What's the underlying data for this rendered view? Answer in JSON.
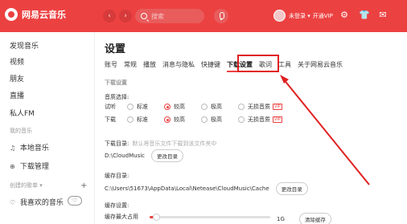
{
  "app": {
    "name": "网易云音乐"
  },
  "titlebar": {
    "back": "‹",
    "forward": "›",
    "search_placeholder": "搜索",
    "user_label": "未登录 ▾",
    "vip_label": "开通VIP"
  },
  "sidebar": {
    "items": [
      {
        "label": "发现音乐"
      },
      {
        "label": "视频"
      },
      {
        "label": "朋友"
      },
      {
        "label": "直播"
      },
      {
        "label": "私人FM"
      }
    ],
    "section_mine": "我的音乐",
    "local_music": "本地音乐",
    "download_manage": "下载管理",
    "section_created": "创建的歌单",
    "created_arrow": "▾",
    "plus": "+",
    "liked": "我喜欢的音乐"
  },
  "settings": {
    "title": "设置",
    "tabs": [
      {
        "label": "账号"
      },
      {
        "label": "常规"
      },
      {
        "label": "播放"
      },
      {
        "label": "消息与隐私"
      },
      {
        "label": "快捷键"
      },
      {
        "label": "下载设置",
        "active": true
      },
      {
        "label": "歌词"
      },
      {
        "label": "工具"
      },
      {
        "label": "关于网易云音乐"
      }
    ],
    "section_download": "下载设置",
    "quality_title": "音质选择:",
    "quality_rows": [
      {
        "label": "试听",
        "options": [
          "标准",
          "较高",
          "极高",
          "无损音质"
        ],
        "selected": 1,
        "vip": "VIP"
      },
      {
        "label": "下载",
        "options": [
          "标准",
          "较高",
          "极高",
          "无损音质"
        ],
        "selected": 1,
        "vip": "VIP"
      }
    ],
    "download_dir": {
      "title": "下载目录:",
      "hint": "默认将音乐文件下载到该文件夹中",
      "path": "D:\\CloudMusic",
      "button": "更改目录"
    },
    "cache_dir": {
      "title": "缓存目录:",
      "path": "C:\\Users\\51673\\AppData\\Local\\Netease\\CloudMusic\\Cache",
      "button": "更改目录"
    },
    "cache_settings": {
      "title": "缓存设置:",
      "max_label": "缓存最大占用",
      "max_value": "1G",
      "max_fraction": 0.05,
      "clear_button": "清除缓存"
    }
  }
}
